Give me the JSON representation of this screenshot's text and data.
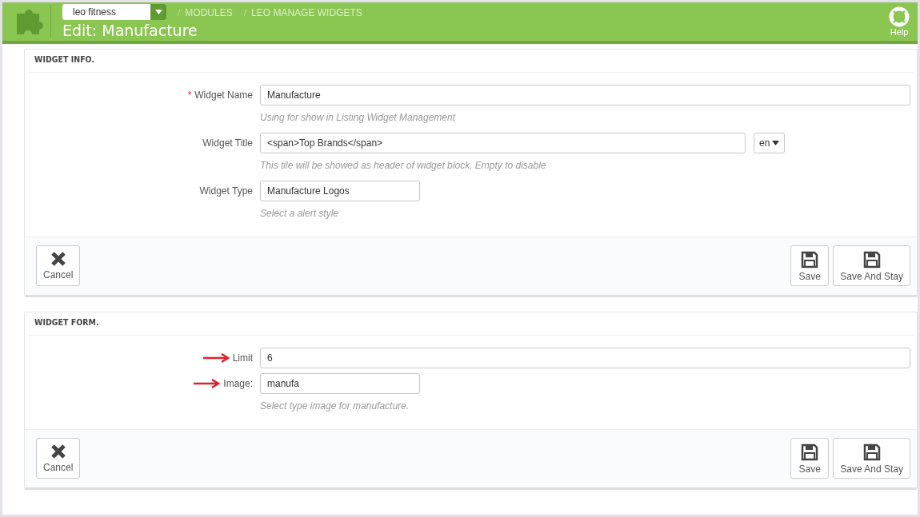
{
  "header": {
    "shop": "leo fitness",
    "breadcrumbs": [
      {
        "separator": "/",
        "label": "MODULES"
      },
      {
        "separator": "/",
        "label": "LEO MANAGE WIDGETS"
      }
    ],
    "required_mark": "*",
    "title": "Edit: Manufacture",
    "help": "Help"
  },
  "panels": [
    {
      "title": "WIDGET INFO.",
      "fields": [
        {
          "kind": "wide",
          "label": "Widget Name",
          "required": true,
          "marked": false,
          "value": "Manufacture",
          "hint": "Using for show in Listing Widget Management"
        },
        {
          "kind": "lang",
          "label": "Widget Title",
          "required": false,
          "marked": false,
          "value": "<span>Top Brands</span>",
          "lang": "en",
          "hint": "This tile will be showed as header of widget block. Empty to disable"
        },
        {
          "kind": "short",
          "label": "Widget Type",
          "required": false,
          "marked": false,
          "value": "Manufacture Logos",
          "hint": "Select a alert style"
        }
      ],
      "buttons": [
        {
          "kind": "cancel",
          "label": "Cancel"
        },
        {
          "kind": "save",
          "label": "Save"
        },
        {
          "kind": "save",
          "label": "Save And Stay"
        }
      ]
    },
    {
      "title": "WIDGET FORM.",
      "fields": [
        {
          "kind": "wide",
          "label": "Limit",
          "required": false,
          "marked": true,
          "value": "6"
        },
        {
          "kind": "short",
          "label": "Image:",
          "required": false,
          "marked": true,
          "value": "manufa",
          "hint": "Select type image for manufacture."
        }
      ],
      "buttons": [
        {
          "kind": "cancel",
          "label": "Cancel"
        },
        {
          "kind": "save",
          "label": "Save"
        },
        {
          "kind": "save",
          "label": "Save And Stay"
        }
      ]
    }
  ]
}
